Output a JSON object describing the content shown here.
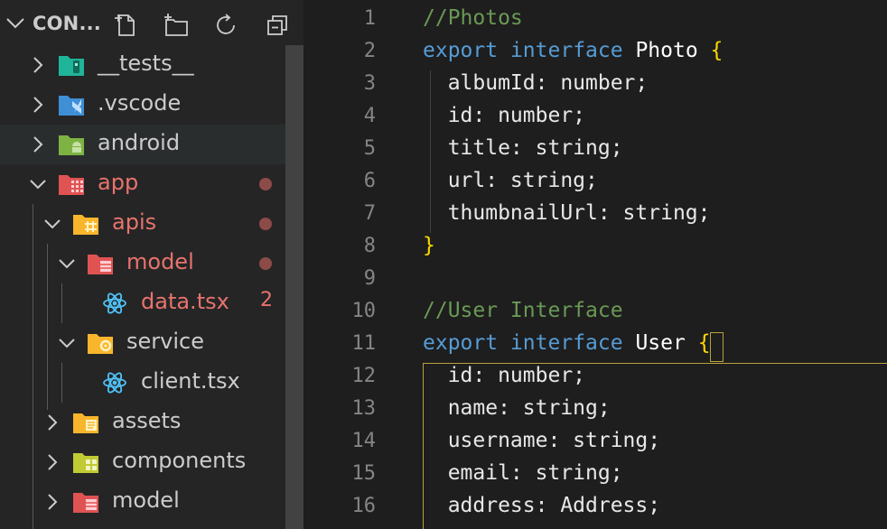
{
  "explorer": {
    "title": "CON...",
    "actions": [
      {
        "name": "new-file",
        "icon": "new-file-icon"
      },
      {
        "name": "new-folder",
        "icon": "new-folder-icon"
      },
      {
        "name": "refresh",
        "icon": "refresh-icon"
      },
      {
        "name": "collapse-all",
        "icon": "collapse-all-icon"
      }
    ],
    "items": [
      {
        "label": "__tests__",
        "icon": "tests-folder-icon",
        "expanded": false,
        "depth": 0
      },
      {
        "label": ".vscode",
        "icon": "vscode-folder-icon",
        "expanded": false,
        "depth": 0
      },
      {
        "label": "android",
        "icon": "android-folder-icon",
        "expanded": false,
        "depth": 0
      },
      {
        "label": "app",
        "icon": "app-folder-icon",
        "expanded": true,
        "depth": 0,
        "status": "modified"
      },
      {
        "label": "apis",
        "icon": "apis-folder-icon",
        "expanded": true,
        "depth": 1,
        "status": "modified"
      },
      {
        "label": "model",
        "icon": "model-folder-icon",
        "expanded": true,
        "depth": 2,
        "status": "modified"
      },
      {
        "label": "data.tsx",
        "icon": "react-icon",
        "depth": 3,
        "status": "modified",
        "problems": "2"
      },
      {
        "label": "service",
        "icon": "service-folder-icon",
        "expanded": true,
        "depth": 2
      },
      {
        "label": "client.tsx",
        "icon": "react-icon",
        "depth": 3
      },
      {
        "label": "assets",
        "icon": "assets-folder-icon",
        "expanded": false,
        "depth": 1
      },
      {
        "label": "components",
        "icon": "components-folder-icon",
        "expanded": false,
        "depth": 1
      },
      {
        "label": "model",
        "icon": "model-folder-icon",
        "expanded": false,
        "depth": 1
      }
    ]
  },
  "editor": {
    "lines": [
      {
        "n": "1",
        "tokens": [
          {
            "t": "//Photos",
            "c": "cm"
          }
        ]
      },
      {
        "n": "2",
        "tokens": [
          {
            "t": "export",
            "c": "kw"
          },
          {
            "t": " ",
            "c": ""
          },
          {
            "t": "interface",
            "c": "kw"
          },
          {
            "t": " ",
            "c": ""
          },
          {
            "t": "Photo",
            "c": "ty"
          },
          {
            "t": " ",
            "c": ""
          },
          {
            "t": "{",
            "c": "br"
          }
        ]
      },
      {
        "n": "3",
        "tokens": [
          {
            "t": "  albumId: number;",
            "c": "prop"
          }
        ]
      },
      {
        "n": "4",
        "tokens": [
          {
            "t": "  id: number;",
            "c": "prop"
          }
        ]
      },
      {
        "n": "5",
        "tokens": [
          {
            "t": "  title: string;",
            "c": "prop"
          }
        ]
      },
      {
        "n": "6",
        "tokens": [
          {
            "t": "  url: string;",
            "c": "prop"
          }
        ]
      },
      {
        "n": "7",
        "tokens": [
          {
            "t": "  thumbnailUrl: string;",
            "c": "prop"
          }
        ]
      },
      {
        "n": "8",
        "tokens": [
          {
            "t": "}",
            "c": "br"
          }
        ]
      },
      {
        "n": "9",
        "tokens": []
      },
      {
        "n": "10",
        "tokens": [
          {
            "t": "//User Interface",
            "c": "cm"
          }
        ]
      },
      {
        "n": "11",
        "tokens": [
          {
            "t": "export",
            "c": "kw"
          },
          {
            "t": " ",
            "c": ""
          },
          {
            "t": "interface",
            "c": "kw"
          },
          {
            "t": " ",
            "c": ""
          },
          {
            "t": "User",
            "c": "ty"
          },
          {
            "t": " ",
            "c": ""
          },
          {
            "t": "{",
            "c": "br"
          }
        ]
      },
      {
        "n": "12",
        "tokens": [
          {
            "t": "  id: number;",
            "c": "prop"
          }
        ]
      },
      {
        "n": "13",
        "tokens": [
          {
            "t": "  name: string;",
            "c": "prop"
          }
        ]
      },
      {
        "n": "14",
        "tokens": [
          {
            "t": "  username: string;",
            "c": "prop"
          }
        ]
      },
      {
        "n": "15",
        "tokens": [
          {
            "t": "  email: string;",
            "c": "prop"
          }
        ]
      },
      {
        "n": "16",
        "tokens": [
          {
            "t": "  address: Address;",
            "c": "prop"
          }
        ]
      }
    ]
  },
  "colors": {
    "modified": "#e8736c",
    "comment": "#6a9955",
    "keyword": "#569cd6",
    "bracket": "#ffd700"
  }
}
